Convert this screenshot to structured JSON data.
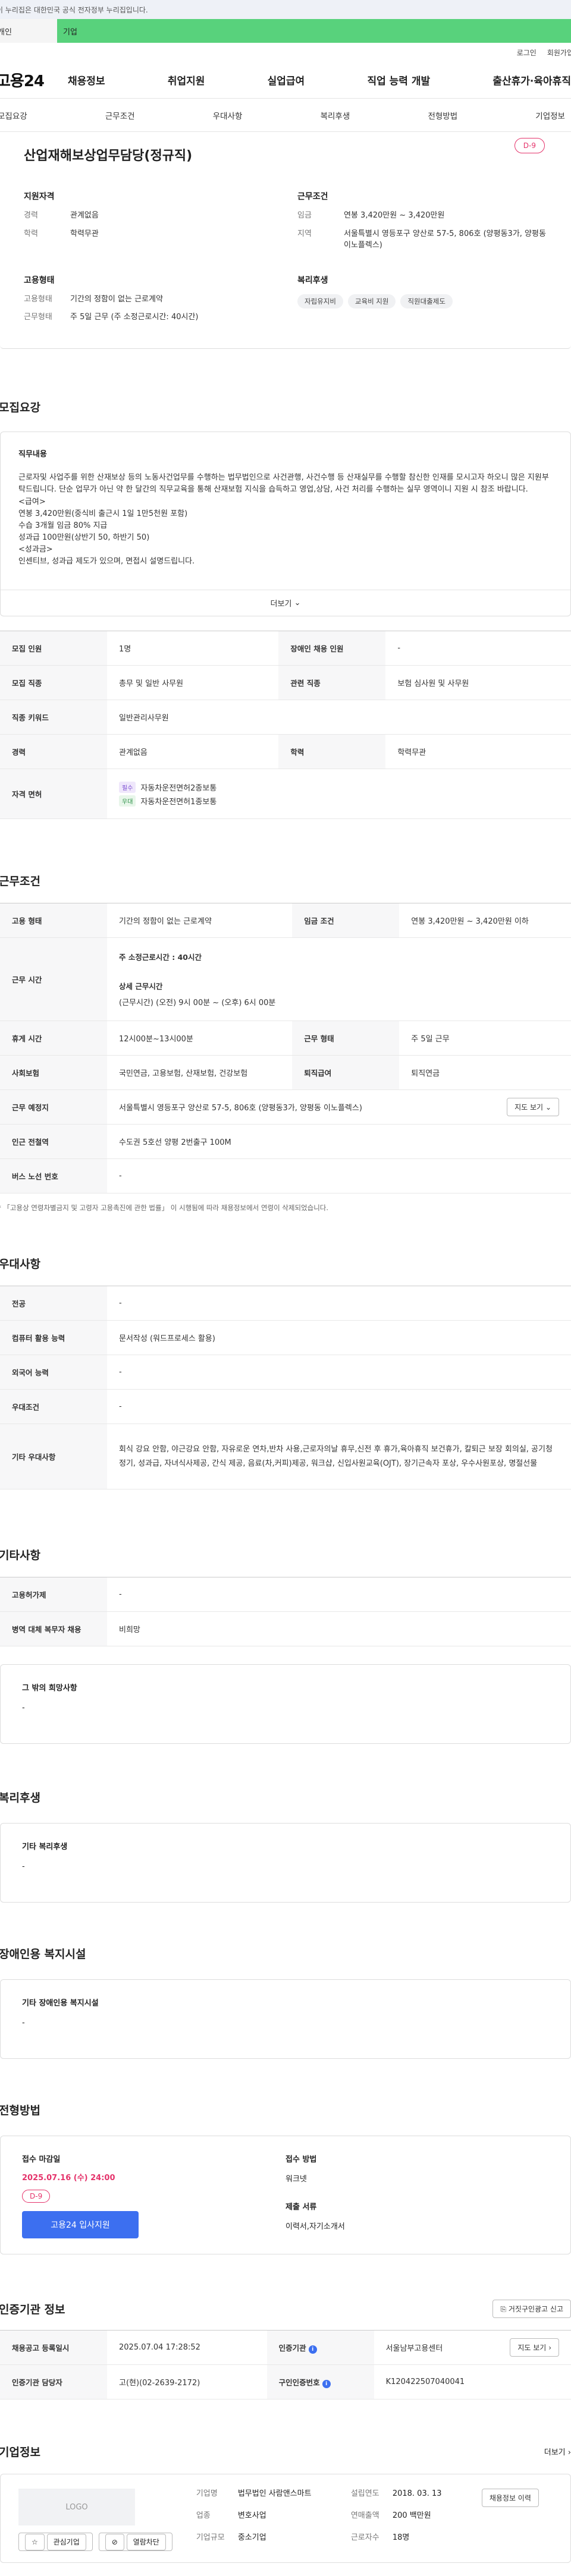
{
  "gov_banner": "이 누리집은 대한민국 공식 전자정부 누리집입니다.",
  "user_tabs": {
    "individual": "개인",
    "business": "기업"
  },
  "util_links": [
    "로그인",
    "회원가입"
  ],
  "logo": {
    "text": "고용24"
  },
  "gnb": [
    "채용정보",
    "취업지원",
    "실업급여",
    "직업 능력 개발",
    "출산휴가·육아휴직"
  ],
  "subnav": [
    "모집요강",
    "근무조건",
    "우대사항",
    "복리후생",
    "전형방법",
    "기업정보"
  ],
  "summary": {
    "title": "산업재해보상업무담당(정규직)",
    "dday": "D-9",
    "qual": {
      "heading": "지원자격",
      "rows": [
        {
          "k": "경력",
          "v": "관계없음"
        },
        {
          "k": "학력",
          "v": "학력무관"
        }
      ]
    },
    "work": {
      "heading": "근무조건",
      "rows": [
        {
          "k": "임금",
          "v": "연봉 3,420만원 ~ 3,420만원"
        },
        {
          "k": "지역",
          "v": "서울특별시 영등포구 양산로 57-5, 806호 (양평동3가, 양평동 이노플렉스)"
        }
      ]
    },
    "emp": {
      "heading": "고용형태",
      "rows": [
        {
          "k": "고용형태",
          "v": "기간의 정함이 없는 근로계약"
        },
        {
          "k": "근무형태",
          "v": "주 5일 근무 (주 소정근로시간: 40시간)"
        }
      ]
    },
    "welfare": {
      "heading": "복리후생",
      "chips": [
        "자립유지비",
        "교육비 지원",
        "직원대출제도"
      ]
    }
  },
  "recruit": {
    "title": "모집요강",
    "duty_heading": "직무내용",
    "duty_text": "근로자및 사업주를 위한 산재보상 등의 노동사건업무를 수행하는 법무법인으로 사건관행, 사건수행 등 산재실무를 수행할 참신한 인재를 모시고자 하오니 많은 지원부탁드립니다. 단순 업무가 아닌  약 한 달간의 직무교육을 통해  산재보험 지식을 습득하고 영업,상담, 사건 처리를 수행하는 실무 영역이니 지원 시 참조 바랍니다.\n<급여>\n연봉 3,420만원(중식비 출근시 1일 1만5천원 포함)\n수습 3개월 임금 80% 지급\n성과급 100만원(상반기 50, 하반기 50)\n<성과금>\n인센티브, 성과급 제도가 있으며, 면접시 설명드립니다.",
    "more_label": "더보기",
    "rows": [
      {
        "k": "모집 인원",
        "v": "1명",
        "k2": "장애인 채용 인원",
        "v2": "-"
      },
      {
        "k": "모집 직종",
        "v": "총무 및 일반 사무원",
        "k2": "관련 직종",
        "v2": "보험 심사원 및 사무원"
      },
      {
        "k": "직종 키워드",
        "v": "일반관리사무원"
      },
      {
        "k": "경력",
        "v": "관계없음",
        "k2": "학력",
        "v2": "학력무관"
      }
    ],
    "license_label": "자격 면허",
    "licenses": [
      {
        "tag": "필수",
        "name": "자동차운전면허2종보통"
      },
      {
        "tag": "우대",
        "name": "자동차운전면허1종보통"
      }
    ]
  },
  "conditions": {
    "title": "근무조건",
    "employment": {
      "k": "고용 형태",
      "v": "기간의 정함이 없는 근로계약",
      "k2": "임금 조건",
      "v2": "연봉 3,420만원 ~ 3,420만원 이하"
    },
    "hours_label": "근무 시간",
    "hours_weekly_label": "주 소정근로시간 :",
    "hours_weekly": "40시간",
    "hours_detail_label": "상세 근무시간",
    "hours_detail": "(근무시간) (오전) 9시 00분 ~ (오후) 6시 00분",
    "rest": {
      "k": "휴게 시간",
      "v": "12시00분~13시00분",
      "k2": "근무 형태",
      "v2": "주 5일 근무"
    },
    "insurance": {
      "k": "사회보험",
      "v": "국민연금, 고용보험, 산재보험, 건강보험",
      "k2": "퇴직급여",
      "v2": "퇴직연금"
    },
    "place": {
      "k": "근무 예정지",
      "v": "서울특별시 영등포구 양산로 57-5, 806호 (양평동3가, 양평동 이노플렉스)",
      "btn": "지도 보기"
    },
    "subway": {
      "k": "인근 전철역",
      "v": "수도권 5호선 양평 2번출구 100M"
    },
    "bus": {
      "k": "버스 노선 번호",
      "v": "-"
    },
    "note": "* 「고용상 연령차별금지 및 고령자 고용촉진에 관한 법률」 이 시행됨에 따라 채용정보에서 연령이 삭제되었습니다."
  },
  "preference": {
    "title": "우대사항",
    "rows": [
      {
        "k": "전공",
        "v": "-"
      },
      {
        "k": "컴퓨터 활용 능력",
        "v": "문서작성 (워드프로세스 활용)"
      },
      {
        "k": "외국어 능력",
        "v": "-"
      },
      {
        "k": "우대조건",
        "v": "-"
      },
      {
        "k": "기타 우대사항",
        "v": "회식 강요 안함, 야근강요 안함, 자유로운 연차,반차 사용,근로자의날 휴무,신전 후 휴가,육아휴직 보건휴가, 칼퇴근 보장 회의실, 공기청정기, 성과급, 자녀식사제공, 간식 제공, 음료(차,커피)제공, 워크샵, 신입사원교육(OJT), 장기근속자 포상, 우수사원포상, 명절선물"
      }
    ]
  },
  "other": {
    "title": "기타사항",
    "rows": [
      {
        "k": "고용허가제",
        "v": "-"
      },
      {
        "k": "병역 대체 복무자 채용",
        "v": "비희망"
      }
    ],
    "hope_heading": "그 밖의 희망사항",
    "hope_value": "-"
  },
  "benefits": {
    "title": "복리후생",
    "heading": "기타 복리후생",
    "value": "-"
  },
  "disability": {
    "title": "장애인용 복지시설",
    "heading": "기타 장애인용 복지시설",
    "value": "-"
  },
  "selection": {
    "title": "전형방법",
    "deadline_label": "접수 마감일",
    "deadline": "2025.07.16 (수) 24:00",
    "dday": "D-9",
    "apply_btn": "고용24 입사지원",
    "method_label": "접수 방법",
    "method": "워크넷",
    "docs_label": "제출 서류",
    "docs": "이력서,자기소개서"
  },
  "agency": {
    "title": "인증기관 정보",
    "report_btn": "거짓구인광고 신고",
    "rows": [
      {
        "k": "채용공고 등록일시",
        "v": "2025.07.04 17:28:52",
        "k2": "인증기관",
        "v2": "서울남부고용센터",
        "btn": "지도 보기"
      },
      {
        "k": "인증기관 담당자",
        "v": "고(현)(02-2639-2172)",
        "k2": "구인인증번호",
        "v2": "K120422507040041"
      }
    ]
  },
  "company": {
    "title": "기업정보",
    "more": "더보기",
    "logo_placeholder": "LOGO",
    "btn_fav": "관심기업",
    "btn_block": "열람차단",
    "col1": [
      {
        "k": "기업명",
        "v": "법무법인 사람앤스마트"
      },
      {
        "k": "업종",
        "v": "변호사업"
      },
      {
        "k": "기업규모",
        "v": "중소기업"
      }
    ],
    "col2": [
      {
        "k": "설립연도",
        "v": "2018. 03. 13"
      },
      {
        "k": "연매출액",
        "v": "200 백만원"
      },
      {
        "k": "근로자수",
        "v": "18명"
      }
    ],
    "jobs_btn": "채용정보 이력"
  }
}
